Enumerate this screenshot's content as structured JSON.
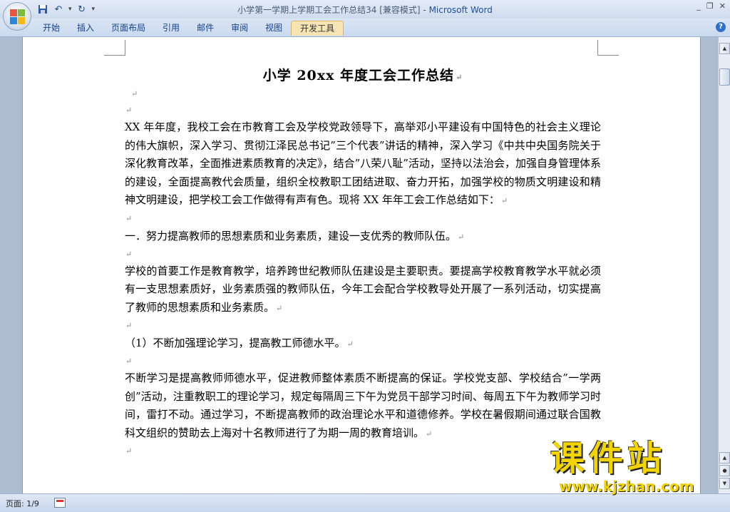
{
  "window": {
    "title": "小学第一学期上学期工会工作总结34 [兼容模式]",
    "separator": " - ",
    "app_name": "Microsoft Word",
    "controls": [
      "_",
      "❐",
      "✕"
    ]
  },
  "quick_access": {
    "save_icon": "save-icon",
    "undo_icon": "undo-icon",
    "redo_icon": "redo-icon",
    "customize_icon": "customize-icon"
  },
  "ribbon": {
    "tabs": [
      {
        "label": "开始"
      },
      {
        "label": "插入"
      },
      {
        "label": "页面布局"
      },
      {
        "label": "引用"
      },
      {
        "label": "邮件"
      },
      {
        "label": "审阅"
      },
      {
        "label": "视图"
      },
      {
        "label": "开发工具",
        "active": true
      }
    ],
    "help_label": "?"
  },
  "document": {
    "title": "小学 20xx 年度工会工作总结",
    "paragraph_mark": "↵",
    "p1": "XX 年年度，我校工会在市教育工会及学校党政领导下，高举邓小平建设有中国特色的社会主义理论的伟大旗帜，深入学习、贯彻江泽民总书记”三个代表”讲话的精神，深入学习《中共中央国务院关于深化教育改革，全面推进素质教育的决定》，结合”八荣八耻”活动，坚持以法治会，加强自身管理体系的建设，全面提高教代会质量，组织全校教职工团结进取、奋力开拓，加强学校的物质文明建设和精神文明建设，把学校工会工作做得有声有色。现将 XX 年年工会工作总结如下：",
    "h1": "一．努力提高教师的思想素质和业务素质，建设一支优秀的教师队伍。",
    "p2": "学校的首要工作是教育教学，培养跨世纪教师队伍建设是主要职责。要提高学校教育教学水平就必须有一支思想素质好，业务素质强的教师队伍，今年工会配合学校教导处开展了一系列活动，切实提高了教师的思想素质和业务素质。",
    "h2": "（1）不断加强理论学习，提高教工师德水平。",
    "p3": "不断学习是提高教师师德水平，促进教师整体素质不断提高的保证。学校党支部、学校结合”一学两创”活动，注重教职工的理论学习，规定每隔周三下午为党员干部学习时间、每周五下午为教师学习时间，雷打不动。通过学习，不断提高教师的政治理论水平和道德修养。学校在暑假期间通过联合国教科文组织的赞助去上海对十名教师进行了为期一周的教育培训。"
  },
  "watermark": {
    "big": "课件站",
    "url": "www.kjzhan.com"
  },
  "status": {
    "page_count": "页面: 1/9"
  }
}
